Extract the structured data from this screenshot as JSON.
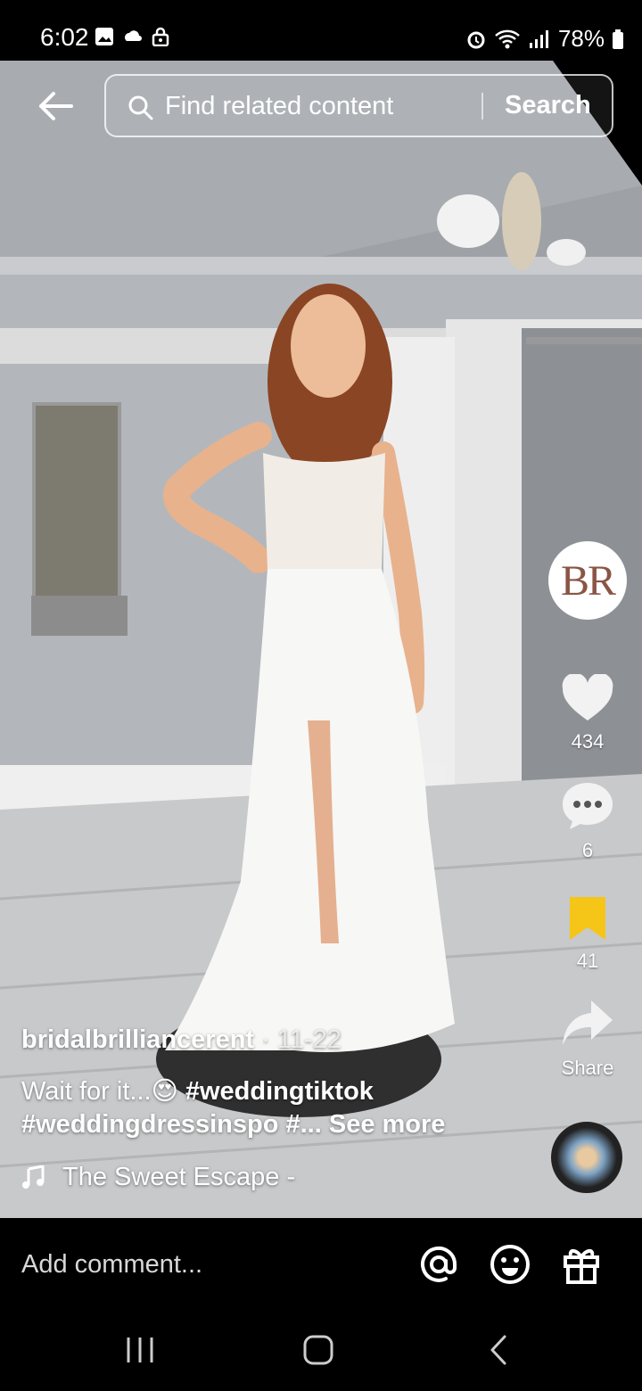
{
  "status_bar": {
    "time": "6:02",
    "battery": "78%"
  },
  "search": {
    "placeholder": "Find related content",
    "button_label": "Search"
  },
  "rail": {
    "creator_avatar_text": "BR",
    "like_count": "434",
    "comment_count": "6",
    "favorite_count": "41",
    "share_label": "Share"
  },
  "post": {
    "username": "bridalbrilliancerent",
    "date": " · 11-22",
    "caption_line1_prefix": "Wait for it...",
    "caption_line1_tag": " #weddingtiktok",
    "caption_line2": "#weddingdressinspo #...",
    "see_more": " See more",
    "music_title": "The Sweet Escape   -"
  },
  "comment_bar": {
    "placeholder": "Add comment..."
  },
  "icons": {
    "back": "arrow-left-icon",
    "search": "magnifier-icon",
    "like": "heart-icon",
    "comment": "speech-bubble-icon",
    "favorite": "bookmark-icon",
    "share": "share-arrow-icon",
    "music": "music-note-icon",
    "mention": "at-sign-icon",
    "emoji": "smiley-icon",
    "gift": "gift-icon"
  },
  "colors": {
    "favorite_active": "#f5c518",
    "like_icon": "#f2f2f2",
    "background": "#000000"
  }
}
